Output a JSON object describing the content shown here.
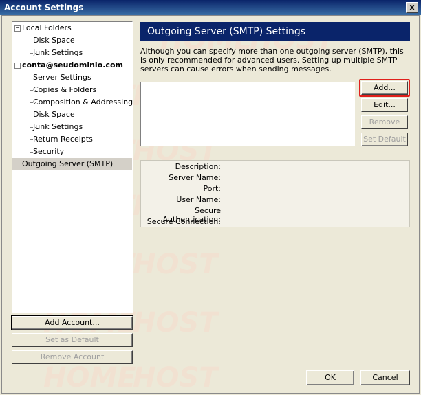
{
  "window": {
    "title": "Account Settings",
    "close_glyph": "x"
  },
  "watermark": {
    "text_home": "HOME",
    "text_host": "HOST"
  },
  "tree": {
    "items": [
      {
        "label": "Local Folders",
        "level": 0,
        "expander": "−"
      },
      {
        "label": "Disk Space",
        "level": 1
      },
      {
        "label": "Junk Settings",
        "level": 1
      },
      {
        "label": "conta@seudominio.com",
        "level": 0,
        "expander": "−",
        "bold": true
      },
      {
        "label": "Server Settings",
        "level": 1
      },
      {
        "label": "Copies & Folders",
        "level": 1
      },
      {
        "label": "Composition & Addressing",
        "level": 1
      },
      {
        "label": "Disk Space",
        "level": 1
      },
      {
        "label": "Junk Settings",
        "level": 1
      },
      {
        "label": "Return Receipts",
        "level": 1
      },
      {
        "label": "Security",
        "level": 1
      },
      {
        "label": "Outgoing Server (SMTP)",
        "level": 0,
        "selected": true
      }
    ]
  },
  "left_buttons": {
    "add_account": "Add Account...",
    "set_default": "Set as Default",
    "remove_account": "Remove Account"
  },
  "panel": {
    "title": "Outgoing Server (SMTP) Settings",
    "description": "Although you can specify more than one outgoing server (SMTP), this is only recommended for advanced users. Setting up multiple SMTP servers can cause errors when sending messages.",
    "buttons": {
      "add": "Add...",
      "edit": "Edit...",
      "remove": "Remove",
      "set_default": "Set Default"
    },
    "details": {
      "description_label": "Description:",
      "server_name_label": "Server Name:",
      "port_label": "Port:",
      "user_name_label": "User Name:",
      "secure_auth_label": "Secure Authentication:",
      "secure_conn_label": "Secure Connection:"
    }
  },
  "footer": {
    "ok": "OK",
    "cancel": "Cancel"
  },
  "colors": {
    "header_bg": "#0a246a",
    "highlight": "#e0201c"
  }
}
